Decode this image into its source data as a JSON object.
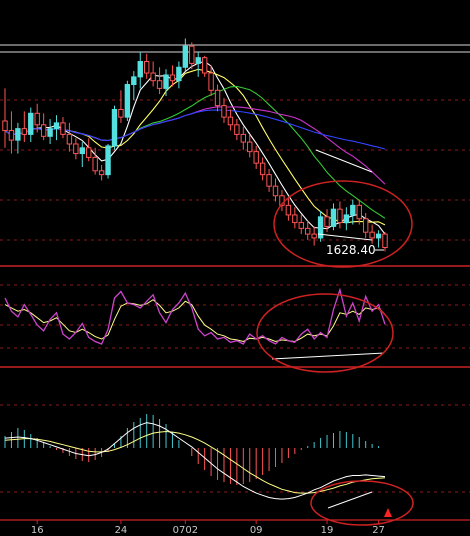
{
  "chart_data": {
    "type": "candlestick",
    "panels": [
      "price",
      "oscillator",
      "macd"
    ],
    "x_tick_labels": [
      "16",
      "24",
      "0702",
      "09",
      "19",
      "27"
    ],
    "grid": "dashed horizontal",
    "price_annotation": "1628.40",
    "candles": [
      {
        "o": 1695,
        "h": 1712,
        "l": 1681,
        "c": 1690
      },
      {
        "o": 1690,
        "h": 1700,
        "l": 1678,
        "c": 1685
      },
      {
        "o": 1685,
        "h": 1694,
        "l": 1678,
        "c": 1691
      },
      {
        "o": 1691,
        "h": 1700,
        "l": 1684,
        "c": 1688
      },
      {
        "o": 1688,
        "h": 1702,
        "l": 1684,
        "c": 1699
      },
      {
        "o": 1699,
        "h": 1704,
        "l": 1689,
        "c": 1693
      },
      {
        "o": 1693,
        "h": 1699,
        "l": 1685,
        "c": 1687
      },
      {
        "o": 1687,
        "h": 1696,
        "l": 1683,
        "c": 1691
      },
      {
        "o": 1691,
        "h": 1698,
        "l": 1685,
        "c": 1694
      },
      {
        "o": 1694,
        "h": 1697,
        "l": 1686,
        "c": 1688
      },
      {
        "o": 1688,
        "h": 1694,
        "l": 1679,
        "c": 1683
      },
      {
        "o": 1683,
        "h": 1686,
        "l": 1675,
        "c": 1678
      },
      {
        "o": 1678,
        "h": 1684,
        "l": 1671,
        "c": 1681
      },
      {
        "o": 1681,
        "h": 1686,
        "l": 1674,
        "c": 1676
      },
      {
        "o": 1676,
        "h": 1681,
        "l": 1667,
        "c": 1669
      },
      {
        "o": 1669,
        "h": 1672,
        "l": 1664,
        "c": 1667
      },
      {
        "o": 1667,
        "h": 1683,
        "l": 1665,
        "c": 1682
      },
      {
        "o": 1682,
        "h": 1703,
        "l": 1680,
        "c": 1701
      },
      {
        "o": 1701,
        "h": 1711,
        "l": 1694,
        "c": 1697
      },
      {
        "o": 1697,
        "h": 1716,
        "l": 1695,
        "c": 1714
      },
      {
        "o": 1714,
        "h": 1721,
        "l": 1706,
        "c": 1718
      },
      {
        "o": 1718,
        "h": 1731,
        "l": 1712,
        "c": 1726
      },
      {
        "o": 1726,
        "h": 1730,
        "l": 1717,
        "c": 1720
      },
      {
        "o": 1720,
        "h": 1726,
        "l": 1713,
        "c": 1716
      },
      {
        "o": 1716,
        "h": 1723,
        "l": 1709,
        "c": 1712
      },
      {
        "o": 1712,
        "h": 1722,
        "l": 1708,
        "c": 1719
      },
      {
        "o": 1719,
        "h": 1724,
        "l": 1713,
        "c": 1716
      },
      {
        "o": 1716,
        "h": 1726,
        "l": 1712,
        "c": 1723
      },
      {
        "o": 1723,
        "h": 1738,
        "l": 1721,
        "c": 1734
      },
      {
        "o": 1734,
        "h": 1736,
        "l": 1722,
        "c": 1725
      },
      {
        "o": 1725,
        "h": 1731,
        "l": 1718,
        "c": 1728
      },
      {
        "o": 1728,
        "h": 1729,
        "l": 1718,
        "c": 1720
      },
      {
        "o": 1720,
        "h": 1724,
        "l": 1708,
        "c": 1711
      },
      {
        "o": 1711,
        "h": 1714,
        "l": 1700,
        "c": 1703
      },
      {
        "o": 1703,
        "h": 1707,
        "l": 1694,
        "c": 1697
      },
      {
        "o": 1697,
        "h": 1701,
        "l": 1690,
        "c": 1693
      },
      {
        "o": 1693,
        "h": 1696,
        "l": 1685,
        "c": 1688
      },
      {
        "o": 1688,
        "h": 1692,
        "l": 1680,
        "c": 1684
      },
      {
        "o": 1684,
        "h": 1688,
        "l": 1676,
        "c": 1679
      },
      {
        "o": 1679,
        "h": 1682,
        "l": 1670,
        "c": 1673
      },
      {
        "o": 1673,
        "h": 1676,
        "l": 1664,
        "c": 1667
      },
      {
        "o": 1667,
        "h": 1670,
        "l": 1658,
        "c": 1661
      },
      {
        "o": 1661,
        "h": 1665,
        "l": 1653,
        "c": 1656
      },
      {
        "o": 1656,
        "h": 1659,
        "l": 1648,
        "c": 1651
      },
      {
        "o": 1651,
        "h": 1655,
        "l": 1643,
        "c": 1646
      },
      {
        "o": 1646,
        "h": 1650,
        "l": 1639,
        "c": 1642
      },
      {
        "o": 1642,
        "h": 1646,
        "l": 1636,
        "c": 1639
      },
      {
        "o": 1639,
        "h": 1643,
        "l": 1633,
        "c": 1636
      },
      {
        "o": 1636,
        "h": 1640,
        "l": 1630,
        "c": 1634
      },
      {
        "o": 1634,
        "h": 1648,
        "l": 1632,
        "c": 1645
      },
      {
        "o": 1645,
        "h": 1649,
        "l": 1637,
        "c": 1640
      },
      {
        "o": 1640,
        "h": 1652,
        "l": 1638,
        "c": 1649
      },
      {
        "o": 1649,
        "h": 1653,
        "l": 1639,
        "c": 1642
      },
      {
        "o": 1642,
        "h": 1650,
        "l": 1638,
        "c": 1646
      },
      {
        "o": 1646,
        "h": 1654,
        "l": 1641,
        "c": 1651
      },
      {
        "o": 1651,
        "h": 1654,
        "l": 1641,
        "c": 1644
      },
      {
        "o": 1644,
        "h": 1647,
        "l": 1634,
        "c": 1637
      },
      {
        "o": 1637,
        "h": 1641,
        "l": 1631,
        "c": 1634
      },
      {
        "o": 1634,
        "h": 1638,
        "l": 1629,
        "c": 1636
      },
      {
        "o": 1636,
        "h": 1637,
        "l": 1627,
        "c": 1629
      }
    ],
    "ma_colors": [
      "#ffffff",
      "#ffff66",
      "#33cc33",
      "#cc33cc",
      "#3344ff"
    ],
    "ma_periods": [
      5,
      10,
      20,
      30,
      60
    ],
    "annotation_color": "#cc2222",
    "osc_fast": [
      78,
      62,
      55,
      70,
      58,
      45,
      38,
      52,
      60,
      34,
      28,
      36,
      47,
      30,
      25,
      22,
      40,
      78,
      86,
      72,
      70,
      66,
      74,
      82,
      60,
      48,
      64,
      72,
      84,
      66,
      40,
      32,
      36,
      28,
      30,
      24,
      26,
      22,
      34,
      28,
      32,
      26,
      22,
      30,
      26,
      24,
      34,
      40,
      28,
      36,
      30,
      64,
      88,
      56,
      72,
      50,
      80,
      62,
      70,
      46
    ],
    "osc_slow": [
      70,
      66,
      62,
      64,
      60,
      54,
      48,
      50,
      54,
      46,
      38,
      36,
      40,
      36,
      31,
      28,
      33,
      52,
      68,
      72,
      71,
      69,
      71,
      76,
      69,
      60,
      62,
      66,
      74,
      70,
      56,
      45,
      40,
      34,
      32,
      28,
      27,
      25,
      29,
      28,
      30,
      28,
      25,
      27,
      26,
      25,
      29,
      34,
      32,
      34,
      32,
      44,
      60,
      58,
      62,
      58,
      66,
      64,
      66,
      58
    ],
    "macd_hist": [
      12,
      16,
      20,
      18,
      14,
      10,
      6,
      2,
      -2,
      -5,
      -8,
      -11,
      -13,
      -14,
      -12,
      -9,
      -4,
      4,
      12,
      20,
      26,
      30,
      34,
      33,
      29,
      24,
      16,
      8,
      0,
      -8,
      -16,
      -22,
      -28,
      -32,
      -34,
      -36,
      -37,
      -36,
      -34,
      -31,
      -27,
      -23,
      -19,
      -15,
      -10,
      -6,
      -2,
      2,
      6,
      10,
      13,
      15,
      17,
      16,
      14,
      11,
      7,
      4,
      2,
      0
    ],
    "macd_dif": [
      18,
      19,
      20,
      19,
      17,
      14,
      10,
      6,
      2,
      -2,
      -6,
      -10,
      -12,
      -14,
      -12,
      -8,
      -2,
      8,
      18,
      28,
      36,
      42,
      46,
      44,
      40,
      34,
      26,
      18,
      10,
      2,
      -8,
      -18,
      -28,
      -38,
      -46,
      -54,
      -62,
      -70,
      -76,
      -82,
      -86,
      -90,
      -92,
      -93,
      -92,
      -90,
      -86,
      -82,
      -76,
      -72,
      -66,
      -60,
      -56,
      -52,
      -50,
      -50,
      -49,
      -50,
      -51,
      -52
    ],
    "macd_dea": [
      14,
      15,
      16,
      17,
      17,
      16,
      14,
      12,
      9,
      6,
      3,
      0,
      -3,
      -6,
      -7,
      -7,
      -6,
      -3,
      1,
      6,
      12,
      18,
      23,
      27,
      29,
      30,
      29,
      27,
      24,
      20,
      15,
      9,
      2,
      -5,
      -13,
      -21,
      -29,
      -37,
      -45,
      -52,
      -59,
      -65,
      -70,
      -75,
      -78,
      -81,
      -82,
      -82,
      -81,
      -79,
      -76,
      -73,
      -69,
      -66,
      -62,
      -60,
      -58,
      -56,
      -55,
      -54
    ]
  }
}
